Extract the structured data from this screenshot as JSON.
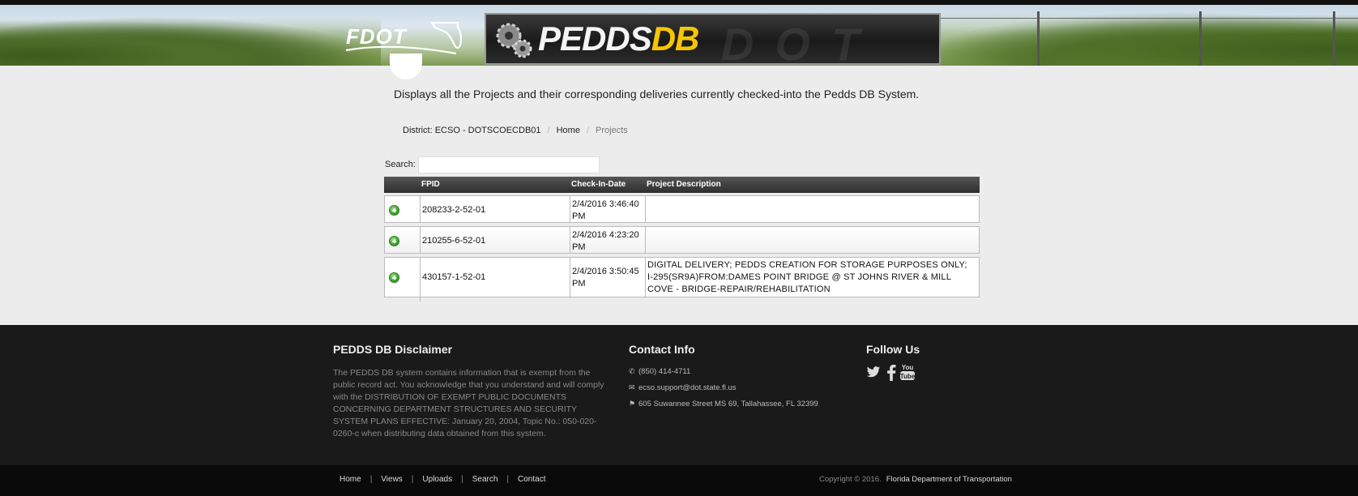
{
  "header": {
    "fdot_logo_text": "FDOT",
    "app_logo": {
      "part1": "PEDDS",
      "part2": "DB",
      "ghost": "DOT"
    }
  },
  "page": {
    "description": "Displays all the Projects and their corresponding deliveries currently checked-into the Pedds DB System."
  },
  "breadcrumb": {
    "district": "District: ECSO - DOTSCOECDB01",
    "home": "Home",
    "current": "Projects"
  },
  "search": {
    "label": "Search:",
    "value": "",
    "placeholder": ""
  },
  "table": {
    "columns": [
      "",
      "FPID",
      "Check-In-Date",
      "Project Description"
    ],
    "rows": [
      {
        "fpid": "208233-2-52-01",
        "date_line1": "2/4/2016 3:46:40",
        "date_line2": "PM",
        "description": ""
      },
      {
        "fpid": "210255-6-52-01",
        "date_line1": "2/4/2016 4:23:20",
        "date_line2": "PM",
        "description": ""
      },
      {
        "fpid": "430157-1-52-01",
        "date_line1": "2/4/2016 3:50:45",
        "date_line2": "PM",
        "description": "DIGITAL DELIVERY; PEDDS CREATION FOR STORAGE PURPOSES ONLY; I-295(SR9A)FROM:DAMES POINT BRIDGE @ ST JOHNS RIVER & MILL COVE - BRIDGE-REPAIR/REHABILITATION"
      }
    ]
  },
  "footer": {
    "disclaimer": {
      "title": "PEDDS DB Disclaimer",
      "text": "The PEDDS DB system contains information that is exempt from the public record act. You acknowledge that you understand and will comply with the DISTRIBUTION OF EXEMPT PUBLIC DOCUMENTS CONCERNING DEPARTMENT STRUCTURES AND SECURITY SYSTEM PLANS EFFECTIVE: January 20, 2004, Topic No.: 050-020-0260-c when distributing data obtained from this system."
    },
    "contact": {
      "title": "Contact Info",
      "phone": "(850) 414-4711",
      "email": "ecso.support@dot.state.fl.us",
      "address": "605 Suwannee Street MS 69, Tallahassee, FL 32399"
    },
    "follow": {
      "title": "Follow Us",
      "icons": [
        "twitter-icon",
        "facebook-icon",
        "youtube-icon"
      ],
      "youtube_text_top": "You",
      "youtube_text_bottom": "Tube"
    }
  },
  "bottom_bar": {
    "nav": [
      "Home",
      "Views",
      "Uploads",
      "Search",
      "Contact"
    ],
    "copyright": "Copyright © 2016.",
    "organization": "Florida Department of Transportation"
  },
  "colors": {
    "accent_yellow": "#f7c600",
    "footer_bg": "#1a1a1a",
    "table_header": "#2e2e2e"
  }
}
